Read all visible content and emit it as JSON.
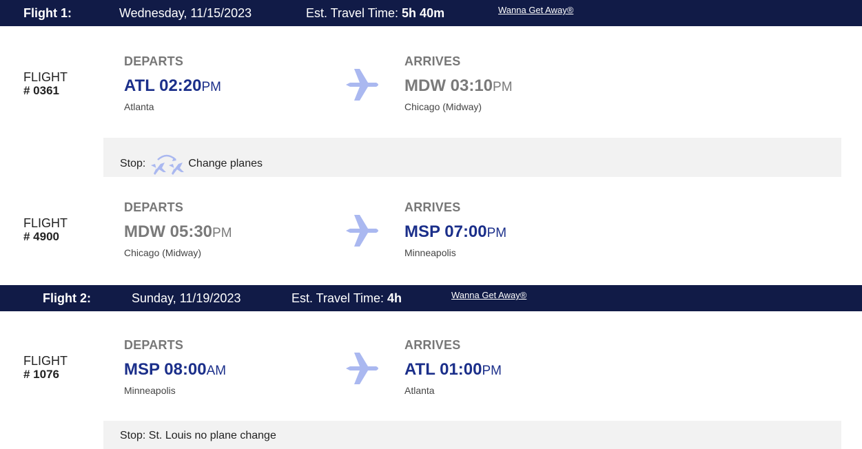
{
  "flights": [
    {
      "header": {
        "label": "Flight 1:",
        "date": "Wednesday, 11/15/2023",
        "travel_prefix": "Est. Travel Time: ",
        "travel_time": "5h 40m",
        "fare": "Wanna Get Away®"
      },
      "segments": [
        {
          "flight_label": "FLIGHT",
          "flight_number": "# 0361",
          "depart": {
            "label": "DEPARTS",
            "code_time": "ATL 02:20",
            "ampm": "PM",
            "city": "Atlanta"
          },
          "arrive": {
            "label": "ARRIVES",
            "code_time": "MDW 03:10",
            "ampm": "PM",
            "city": "Chicago (Midway)"
          }
        },
        {
          "flight_label": "FLIGHT",
          "flight_number": "# 4900",
          "depart": {
            "label": "DEPARTS",
            "code_time": "MDW 05:30",
            "ampm": "PM",
            "city": "Chicago (Midway)"
          },
          "arrive": {
            "label": "ARRIVES",
            "code_time": "MSP 07:00",
            "ampm": "PM",
            "city": "Minneapolis"
          }
        }
      ],
      "stop": {
        "prefix": "Stop:",
        "text": "Change planes",
        "icon": "change-planes-icon"
      }
    },
    {
      "header": {
        "label": "Flight 2:",
        "date": "Sunday, 11/19/2023",
        "travel_prefix": "Est. Travel Time: ",
        "travel_time": "4h",
        "fare": "Wanna Get Away®"
      },
      "segments": [
        {
          "flight_label": "FLIGHT",
          "flight_number": "# 1076",
          "depart": {
            "label": "DEPARTS",
            "code_time": "MSP 08:00",
            "ampm": "AM",
            "city": "Minneapolis"
          },
          "arrive": {
            "label": "ARRIVES",
            "code_time": "ATL 01:00",
            "ampm": "PM",
            "city": "Atlanta"
          }
        }
      ],
      "stop": {
        "text": "Stop: St. Louis no plane change"
      }
    }
  ],
  "colors": {
    "header_bg": "#111b47",
    "time_blue": "#1b2f8a",
    "time_gray": "#7a7a7a",
    "plane_icon": "#aab8f0",
    "stop_bg": "#f2f2f2"
  }
}
